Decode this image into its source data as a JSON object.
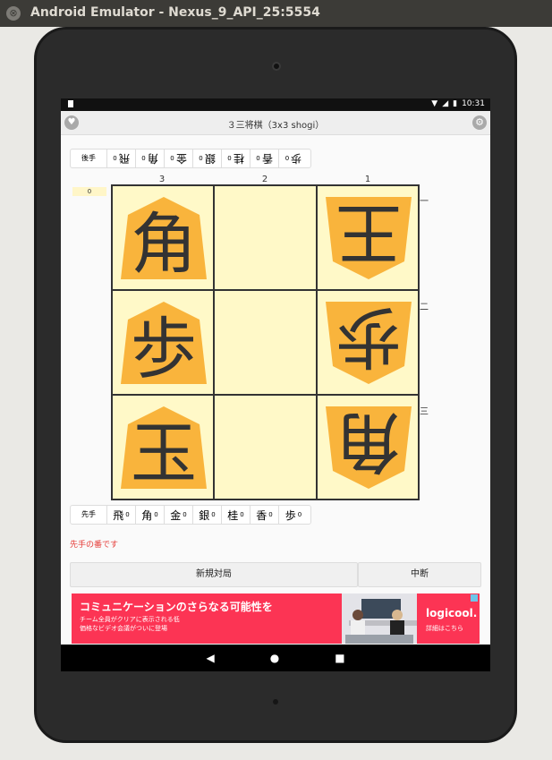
{
  "window": {
    "title": "Android Emulator - Nexus_9_API_25:5554",
    "close_glyph": "⊗"
  },
  "status_bar": {
    "time": "10:31"
  },
  "app_bar": {
    "title": "３三将棋（3x3 shogi）"
  },
  "gote_hand": {
    "label": "後手",
    "pieces": [
      {
        "name": "飛",
        "count": "0"
      },
      {
        "name": "角",
        "count": "0"
      },
      {
        "name": "金",
        "count": "0"
      },
      {
        "name": "銀",
        "count": "0"
      },
      {
        "name": "桂",
        "count": "0"
      },
      {
        "name": "香",
        "count": "0"
      },
      {
        "name": "歩",
        "count": "0"
      }
    ]
  },
  "sente_hand": {
    "label": "先手",
    "pieces": [
      {
        "name": "飛",
        "count": "0"
      },
      {
        "name": "角",
        "count": "0"
      },
      {
        "name": "金",
        "count": "0"
      },
      {
        "name": "銀",
        "count": "0"
      },
      {
        "name": "桂",
        "count": "0"
      },
      {
        "name": "香",
        "count": "0"
      },
      {
        "name": "歩",
        "count": "0"
      }
    ]
  },
  "score": "0",
  "board": {
    "column_labels": [
      "3",
      "2",
      "1"
    ],
    "row_labels": [
      "一",
      "二",
      "三"
    ],
    "squares": [
      [
        {
          "piece": "角",
          "owner": "sente"
        },
        {
          "piece": "",
          "owner": ""
        },
        {
          "piece": "王",
          "owner": "gote"
        }
      ],
      [
        {
          "piece": "歩",
          "owner": "sente"
        },
        {
          "piece": "",
          "owner": ""
        },
        {
          "piece": "歩",
          "owner": "gote"
        }
      ],
      [
        {
          "piece": "玉",
          "owner": "sente"
        },
        {
          "piece": "",
          "owner": ""
        },
        {
          "piece": "角",
          "owner": "gote"
        }
      ]
    ],
    "piece_color": "#f9b43c",
    "square_color": "#fff9c8"
  },
  "turn_message": "先手の番です",
  "buttons": {
    "new_game": "新規対局",
    "abort": "中断"
  },
  "ad": {
    "headline": "コミュニケーションのさらなる可能性を",
    "line1": "チーム全員がクリアに表示される低",
    "line2": "価格なビデオ会議がついに登場",
    "brand": "logicool.",
    "detail": "詳細はこちら"
  },
  "nav": {
    "back": "◀",
    "home": "●",
    "recents": "■"
  }
}
